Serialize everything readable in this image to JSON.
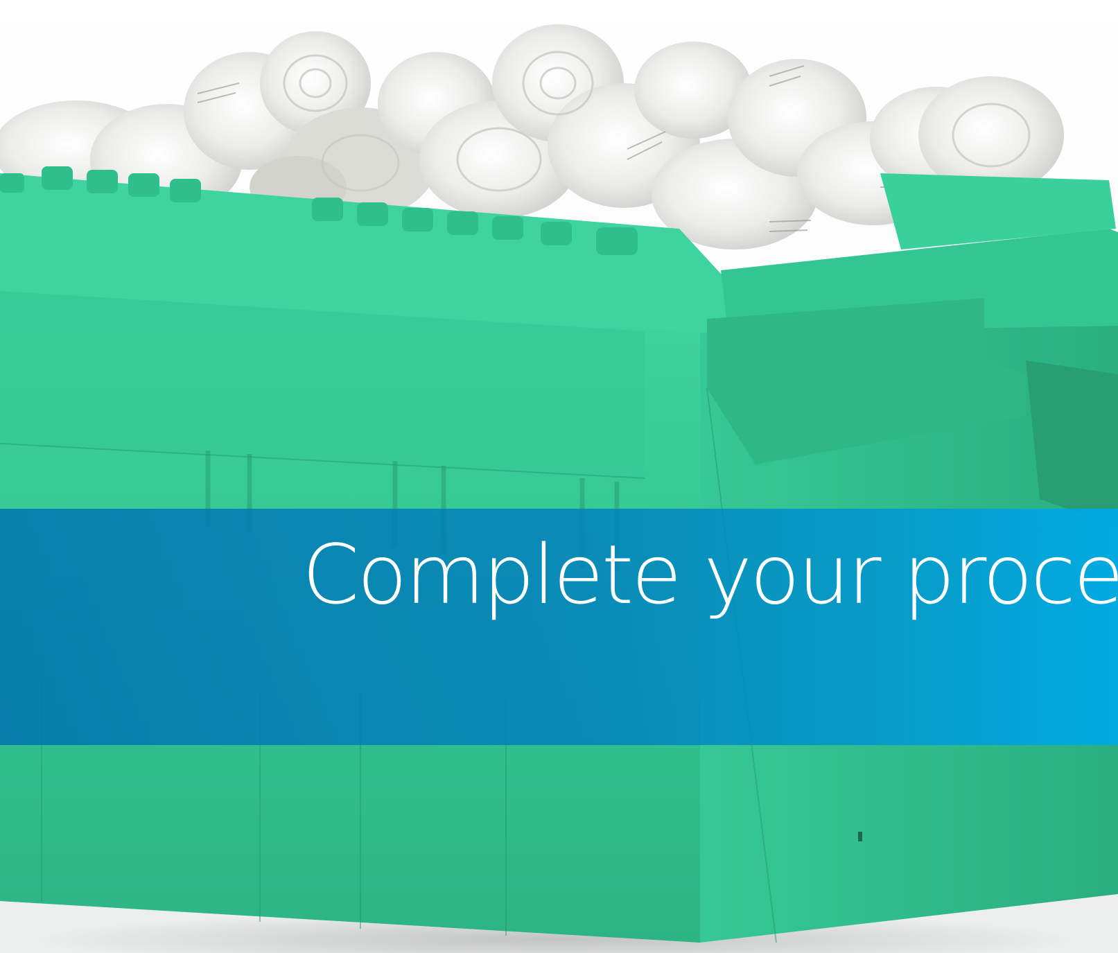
{
  "banner": {
    "headline": "Complete your process",
    "color": "#0a86c2"
  },
  "photo": {
    "subject": "green plastic crate filled with rolled paper receipts",
    "crate_color": "#35c795",
    "paper_color": "#e9e9e6"
  }
}
